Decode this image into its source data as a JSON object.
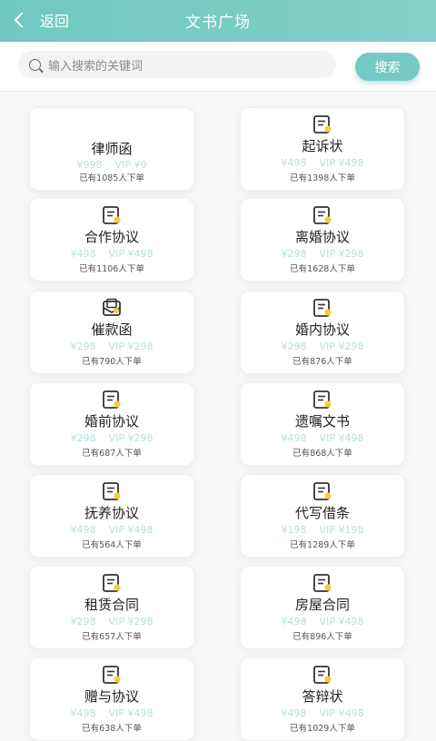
{
  "header": {
    "back_label": "返回",
    "title": "文书广场"
  },
  "search": {
    "placeholder": "输入搜索的关键词",
    "button_label": "搜索"
  },
  "documents": [
    {
      "title": "律师函",
      "price": "¥998",
      "vip": "VIP ¥0",
      "count": "已有1085人下单",
      "icon": "none"
    },
    {
      "title": "起诉状",
      "price": "¥498",
      "vip": "VIP ¥498",
      "count": "已有1398人下单",
      "icon": "document-icon"
    },
    {
      "title": "合作协议",
      "price": "¥498",
      "vip": "VIP ¥498",
      "count": "已有1106人下单",
      "icon": "document-icon"
    },
    {
      "title": "离婚协议",
      "price": "¥298",
      "vip": "VIP ¥298",
      "count": "已有1628人下单",
      "icon": "document-icon"
    },
    {
      "title": "催款函",
      "price": "¥298",
      "vip": "VIP ¥298",
      "count": "已有790人下单",
      "icon": "envelope-icon"
    },
    {
      "title": "婚内协议",
      "price": "¥298",
      "vip": "VIP ¥298",
      "count": "已有876人下单",
      "icon": "document-icon"
    },
    {
      "title": "婚前协议",
      "price": "¥298",
      "vip": "VIP ¥298",
      "count": "已有687人下单",
      "icon": "document-icon"
    },
    {
      "title": "遗嘱文书",
      "price": "¥498",
      "vip": "VIP ¥498",
      "count": "已有868人下单",
      "icon": "document-icon"
    },
    {
      "title": "抚养协议",
      "price": "¥498",
      "vip": "VIP ¥498",
      "count": "已有564人下单",
      "icon": "document-icon"
    },
    {
      "title": "代写借条",
      "price": "¥198",
      "vip": "VIP ¥198",
      "count": "已有1289人下单",
      "icon": "document-icon"
    },
    {
      "title": "租赁合同",
      "price": "¥298",
      "vip": "VIP ¥298",
      "count": "已有657人下单",
      "icon": "document-icon"
    },
    {
      "title": "房屋合同",
      "price": "¥498",
      "vip": "VIP ¥498",
      "count": "已有896人下单",
      "icon": "document-icon"
    },
    {
      "title": "赠与协议",
      "price": "¥498",
      "vip": "VIP ¥498",
      "count": "已有638人下单",
      "icon": "document-icon"
    },
    {
      "title": "答辩状",
      "price": "¥498",
      "vip": "VIP ¥498",
      "count": "已有1029人下单",
      "icon": "document-icon"
    }
  ]
}
